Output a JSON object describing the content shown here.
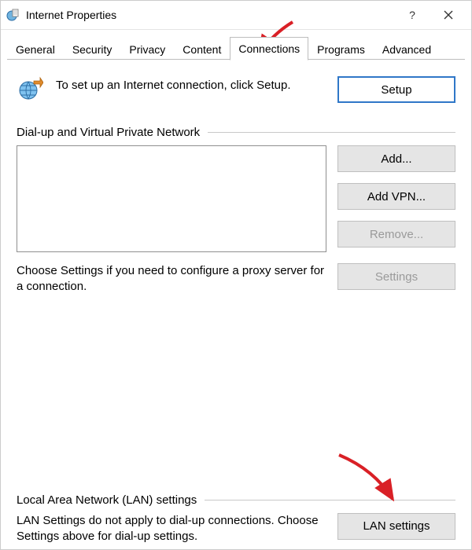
{
  "window": {
    "title": "Internet Properties"
  },
  "tabs": {
    "general": "General",
    "security": "Security",
    "privacy": "Privacy",
    "content": "Content",
    "connections": "Connections",
    "programs": "Programs",
    "advanced": "Advanced"
  },
  "setup": {
    "text": "To set up an Internet connection, click Setup.",
    "button": "Setup"
  },
  "dialup": {
    "heading": "Dial-up and Virtual Private Network",
    "add": "Add...",
    "add_vpn": "Add VPN...",
    "remove": "Remove...",
    "helper": "Choose Settings if you need to configure a proxy server for a connection.",
    "settings": "Settings"
  },
  "lan": {
    "heading": "Local Area Network (LAN) settings",
    "text": "LAN Settings do not apply to dial-up connections. Choose Settings above for dial-up settings.",
    "button": "LAN settings"
  },
  "colors": {
    "arrow": "#d92026"
  }
}
